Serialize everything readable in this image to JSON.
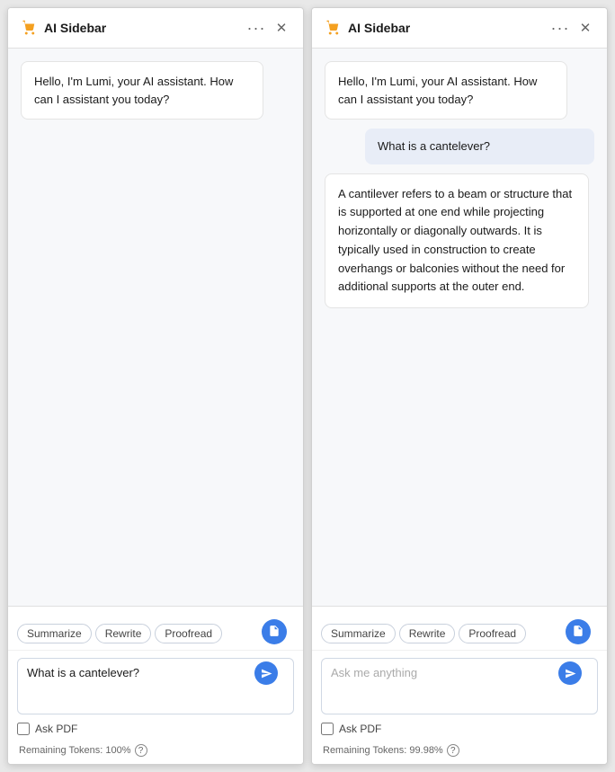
{
  "sidebars": [
    {
      "id": "left",
      "header": {
        "title": "AI Sidebar",
        "cart_icon": "🛒",
        "more_icon": "···",
        "close_icon": "✕"
      },
      "messages": [
        {
          "type": "ai",
          "text": "Hello, I'm Lumi, your AI assistant. How can I assistant you today?"
        }
      ],
      "footer": {
        "actions": [
          "Summarize",
          "Rewrite",
          "Proofread"
        ],
        "input_value": "What is a cantelever?",
        "input_placeholder": "Ask me anything",
        "ask_pdf_label": "Ask PDF",
        "tokens_label": "Remaining Tokens: 100%"
      }
    },
    {
      "id": "right",
      "header": {
        "title": "AI Sidebar",
        "cart_icon": "🛒",
        "more_icon": "···",
        "close_icon": "✕"
      },
      "messages": [
        {
          "type": "ai",
          "text": "Hello, I'm Lumi, your AI assistant. How can I assistant you today?"
        },
        {
          "type": "user",
          "text": "What is a cantelever?"
        },
        {
          "type": "ai",
          "text": "A cantilever refers to a beam or structure that is supported at one end while projecting horizontally or diagonally outwards. It is typically used in construction to create overhangs or balconies without the need for additional supports at the outer end."
        }
      ],
      "footer": {
        "actions": [
          "Summarize",
          "Rewrite",
          "Proofread"
        ],
        "input_value": "",
        "input_placeholder": "Ask me anything",
        "ask_pdf_label": "Ask PDF",
        "tokens_label": "Remaining Tokens: 99.98%"
      }
    }
  ]
}
